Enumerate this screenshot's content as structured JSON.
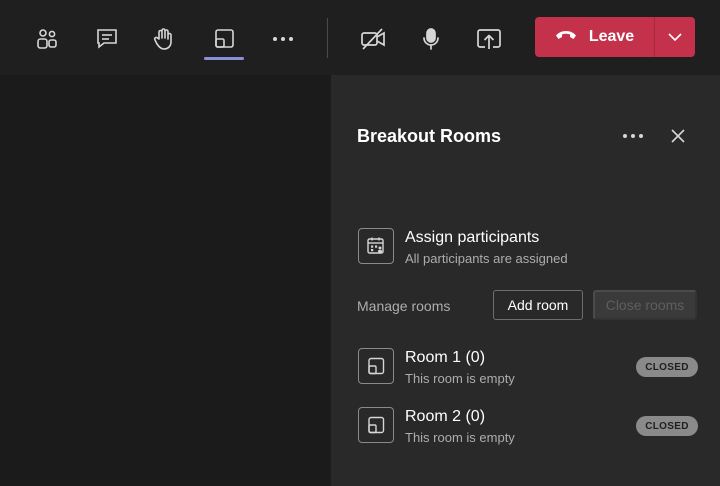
{
  "toolbar": {
    "icons": {
      "people": "people-icon",
      "chat": "chat-icon",
      "raise_hand": "raise-hand-icon",
      "breakout_rooms": "breakout-rooms-icon",
      "more": "more-actions-icon",
      "camera": "camera-off-icon",
      "mic": "microphone-icon",
      "share": "share-screen-icon"
    },
    "leave": {
      "label": "Leave",
      "color": "#c4314b"
    }
  },
  "panel": {
    "title": "Breakout Rooms",
    "assign": {
      "title": "Assign participants",
      "subtitle": "All participants are assigned"
    },
    "manage": {
      "label": "Manage rooms",
      "add_room": "Add room",
      "close_rooms": "Close rooms"
    },
    "rooms": [
      {
        "name": "Room 1 (0)",
        "status": "This room is empty",
        "badge": "CLOSED"
      },
      {
        "name": "Room 2 (0)",
        "status": "This room is empty",
        "badge": "CLOSED"
      }
    ]
  },
  "colors": {
    "accent": "#8b8fd6",
    "panel_bg": "#292929",
    "stage_bg": "#1b1b1b",
    "toolbar_bg": "#1f1f1f"
  }
}
